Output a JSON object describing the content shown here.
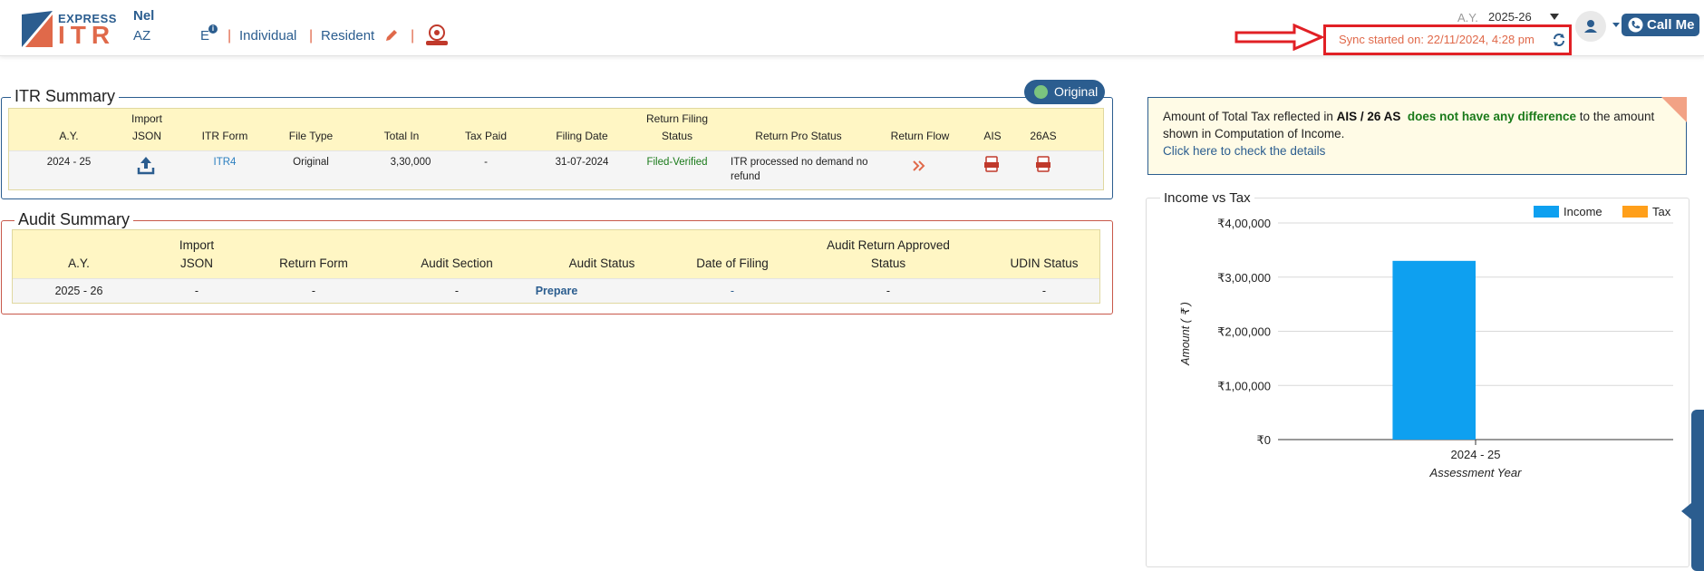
{
  "header": {
    "logo_express": "EXPRESS",
    "logo_itr": "ITR",
    "user_name": "Nel",
    "user_code": "AZ",
    "e_tag": "E",
    "info_badge": "i",
    "separator": "|",
    "status_individual": "Individual",
    "status_resident": "Resident",
    "ay_label": "A.Y.",
    "ay_value": "2025-26",
    "call_me": "Call Me",
    "sync_text": "Sync started on: 22/11/2024, 4:28 pm"
  },
  "itr_summary": {
    "title": "ITR Summary",
    "badge": "Original",
    "headers": [
      [
        "A.Y."
      ],
      [
        "Import",
        "JSON"
      ],
      [
        "ITR Form"
      ],
      [
        "File Type"
      ],
      [
        "Total In"
      ],
      [
        "Tax Paid"
      ],
      [
        "Filing Date"
      ],
      [
        "Return Filing",
        "Status"
      ],
      [
        "Return Pro Status"
      ],
      [
        "Return Flow"
      ],
      [
        "AIS"
      ],
      [
        "26AS"
      ]
    ],
    "row": {
      "ay": "2024 - 25",
      "itr_form": "ITR4",
      "file_type": "Original",
      "total_in": "3,30,000",
      "tax_paid": "-",
      "filing_date": "31-07-2024",
      "filing_status": "Filed-Verified",
      "pro_status_l1": "ITR processed no demand no",
      "pro_status_l2": "refund"
    }
  },
  "audit_summary": {
    "title": "Audit Summary",
    "headers": [
      [
        "A.Y."
      ],
      [
        "Import",
        "JSON"
      ],
      [
        "Return Form"
      ],
      [
        "Audit Section"
      ],
      [
        "Audit Status"
      ],
      [
        "Date of Filing"
      ],
      [
        "Audit Return Approved",
        "Status"
      ],
      [
        "UDIN Status"
      ]
    ],
    "row": {
      "ay": "2025 - 26",
      "import_json": "-",
      "return_form": "-",
      "audit_section": "-",
      "audit_status": "Prepare",
      "date_of_filing": "-",
      "approved_status": "-",
      "udin_status": "-"
    }
  },
  "ais_notice": {
    "prefix": "Amount of Total Tax reflected in ",
    "bold": "AIS / 26 AS",
    "green": "does not have any difference",
    "suffix": " to the amount shown in Computation of Income.",
    "link": "Click here to check the details"
  },
  "colors": {
    "brand_blue": "#2b5d8f",
    "accent_orange": "#e0694a",
    "income": "#0ea0f0",
    "tax": "#ff9f1a",
    "highlight_red": "#e12025"
  },
  "chart_data": {
    "type": "bar",
    "title": "Income vs Tax",
    "categories": [
      "2024 - 25"
    ],
    "series": [
      {
        "name": "Income",
        "values": [
          330000
        ],
        "color": "#0ea0f0"
      },
      {
        "name": "Tax",
        "values": [
          0
        ],
        "color": "#ff9f1a"
      }
    ],
    "xlabel": "Assessment Year",
    "ylabel": "Amount ( ₹ )",
    "ylim": [
      0,
      400000
    ],
    "y_ticks": [
      {
        "value": 0,
        "label": "₹0"
      },
      {
        "value": 100000,
        "label": "₹1,00,000"
      },
      {
        "value": 200000,
        "label": "₹2,00,000"
      },
      {
        "value": 300000,
        "label": "₹3,00,000"
      },
      {
        "value": 400000,
        "label": "₹4,00,000"
      }
    ],
    "grid": true,
    "legend_position": "top-right"
  }
}
